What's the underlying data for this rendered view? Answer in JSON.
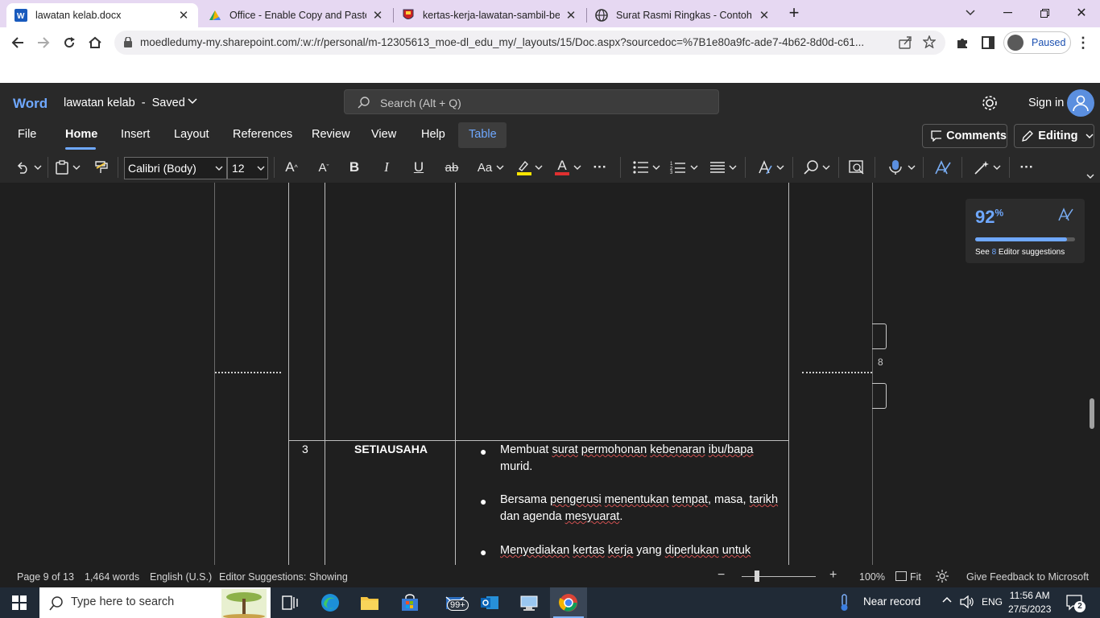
{
  "browser": {
    "tabs": [
      {
        "title": "lawatan kelab.docx",
        "active": true,
        "icon": "word-icon"
      },
      {
        "title": "Office - Enable Copy and Paste -",
        "active": false,
        "icon": "office-drive-icon"
      },
      {
        "title": "kertas-kerja-lawatan-sambil-bela",
        "active": false,
        "icon": "school-logo-icon"
      },
      {
        "title": "Surat Rasmi Ringkas - Contoh Fo",
        "active": false,
        "icon": "globe-icon"
      }
    ],
    "url": "moedledumy-my.sharepoint.com/:w:/r/personal/m-12305613_moe-dl_edu_my/_layouts/15/Doc.aspx?sourcedoc=%7B1e80a9fc-ade7-4b62-8d0d-c61...",
    "profile_label": "Paused"
  },
  "word": {
    "brand": "Word",
    "doc_title": "lawatan kelab",
    "doc_status": "Saved",
    "title_separator": "-",
    "search_placeholder": "Search (Alt + Q)",
    "sign_in": "Sign in",
    "ribbon_tabs": [
      "File",
      "Home",
      "Insert",
      "Layout",
      "References",
      "Review",
      "View",
      "Help",
      "Table"
    ],
    "active_tab": "Home",
    "comments_label": "Comments",
    "editing_label": "Editing",
    "font_name": "Calibri (Body)",
    "font_size": "12",
    "toolbar": {
      "grow_font": "A",
      "shrink_font": "A",
      "bold": "B",
      "italic": "I",
      "underline": "U",
      "strikethrough": "ab",
      "change_case": "Aa",
      "font_color": "A",
      "more": "···",
      "highlight_color": "#ffe600",
      "font_color_value": "#e03030"
    }
  },
  "document": {
    "row_number": "3",
    "role": "SETIAUSAHA",
    "duties": [
      [
        {
          "t": "Membuat",
          "sq": false
        },
        {
          "t": " ",
          "sq": false
        },
        {
          "t": "surat",
          "sq": true
        },
        {
          "t": " ",
          "sq": false
        },
        {
          "t": "permohonan",
          "sq": true
        },
        {
          "t": " ",
          "sq": false
        },
        {
          "t": "kebenaran",
          "sq": true
        },
        {
          "t": " ",
          "sq": false
        },
        {
          "t": "ibu/bapa",
          "sq": true
        },
        {
          "t": " murid.",
          "sq": false
        }
      ],
      [
        {
          "t": "Bersama ",
          "sq": false
        },
        {
          "t": "pengerusi",
          "sq": true
        },
        {
          "t": " ",
          "sq": false
        },
        {
          "t": "menentukan",
          "sq": true
        },
        {
          "t": " ",
          "sq": false
        },
        {
          "t": "tempat",
          "sq": true
        },
        {
          "t": ", masa, ",
          "sq": false
        },
        {
          "t": "tarikh",
          "sq": true
        },
        {
          "t": " dan agenda ",
          "sq": false
        },
        {
          "t": "mesyuarat",
          "sq": true
        },
        {
          "t": ".",
          "sq": false
        }
      ],
      [
        {
          "t": "Menyediakan",
          "sq": true
        },
        {
          "t": " ",
          "sq": false
        },
        {
          "t": "kertas",
          "sq": true
        },
        {
          "t": " ",
          "sq": false
        },
        {
          "t": "kerja",
          "sq": true
        },
        {
          "t": " yang ",
          "sq": false
        },
        {
          "t": "diperlukan",
          "sq": true
        },
        {
          "t": " ",
          "sq": false
        },
        {
          "t": "untuk",
          "sq": true
        }
      ]
    ],
    "margin_page_number": "8",
    "editor_score": "92",
    "editor_score_unit": "%",
    "editor_score_fraction": 0.92,
    "editor_suggestions_prefix": "See ",
    "editor_suggestions_count": "8",
    "editor_suggestions_suffix": " Editor suggestions"
  },
  "status": {
    "page": "Page 9 of 13",
    "words": "1,464 words",
    "language": "English (U.S.)",
    "editor": "Editor Suggestions: Showing",
    "zoom": "100%",
    "fit": "Fit",
    "feedback": "Give Feedback to Microsoft"
  },
  "taskbar": {
    "search_placeholder": "Type here to search",
    "mail_badge": "99+",
    "near_record": "Near record",
    "language": "ENG",
    "time": "11:56 AM",
    "date": "27/5/2023",
    "notifications": "2"
  }
}
